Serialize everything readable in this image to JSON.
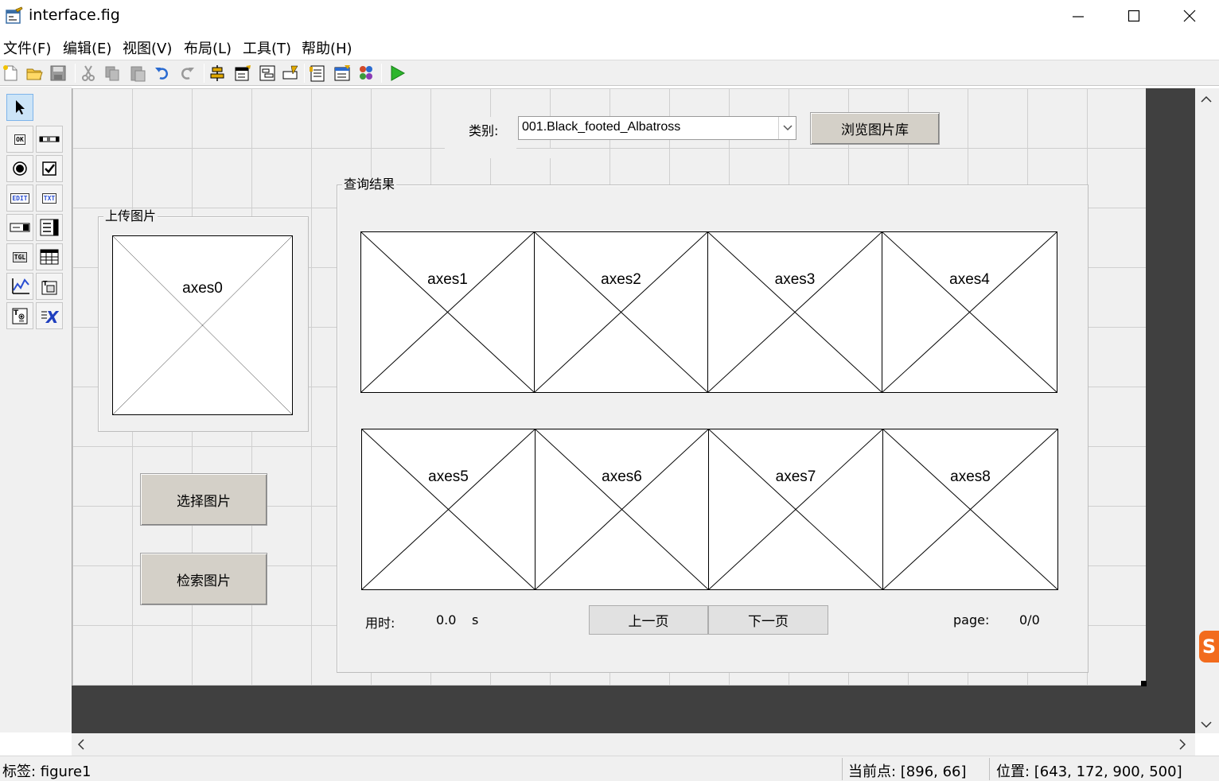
{
  "window": {
    "title": "interface.fig",
    "icon": "guide-figure-icon"
  },
  "menu": [
    {
      "label": "文件(F)"
    },
    {
      "label": "编辑(E)"
    },
    {
      "label": "视图(V)"
    },
    {
      "label": "布局(L)"
    },
    {
      "label": "工具(T)"
    },
    {
      "label": "帮助(H)"
    }
  ],
  "toolbar": {
    "icons": [
      "new-file-icon",
      "open-folder-icon",
      "save-icon",
      "cut-icon",
      "copy-icon",
      "paste-icon",
      "undo-icon",
      "redo-icon",
      "align-objects-icon",
      "menu-editor-icon",
      "tab-order-icon",
      "toolbar-editor-icon",
      "editor-icon",
      "property-inspector-icon",
      "object-browser-icon",
      "run-figure-icon"
    ]
  },
  "palette": {
    "tools": [
      "select-tool",
      "push-button",
      "slider",
      "radio-button",
      "check-box",
      "edit-text",
      "static-text",
      "popup-menu",
      "listbox",
      "toggle-button",
      "table",
      "axes",
      "panel",
      "button-group",
      "activex-control"
    ],
    "labels": {
      "ok": "OK",
      "edit": "EDIT",
      "txt": "TXT",
      "tgl": "TGL"
    }
  },
  "category": {
    "label": "类别:",
    "selected": "001.Black_footed_Albatross",
    "browse_button": "浏览图片库"
  },
  "upload_panel": {
    "title": "上传图片",
    "axes_label": "axes0"
  },
  "buttons": {
    "select_image": "选择图片",
    "search_image": "检索图片"
  },
  "results_panel": {
    "title": "查询结果",
    "axes": [
      "axes1",
      "axes2",
      "axes3",
      "axes4",
      "axes5",
      "axes6",
      "axes7",
      "axes8"
    ],
    "time_label": "用时:",
    "time_value": "0.0",
    "time_unit": "s",
    "prev_button": "上一页",
    "next_button": "下一页",
    "page_label": "page:",
    "page_value": "0/0"
  },
  "statusbar": {
    "tag": "标签: figure1",
    "current_point": "当前点:  [896, 66]",
    "position": "位置: [643, 172, 900, 500]"
  },
  "ime": {
    "badge": "S"
  }
}
